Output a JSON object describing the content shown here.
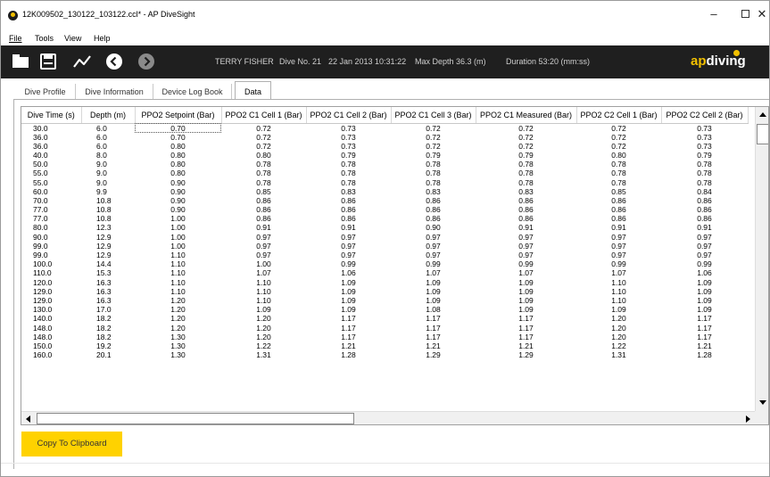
{
  "window": {
    "title": "12K009502_130122_103122.ccl* - AP DiveSight",
    "minimize": "–",
    "maximize": "",
    "close": "✕"
  },
  "menu": {
    "file": "File",
    "tools": "Tools",
    "view": "View",
    "help": "Help"
  },
  "toolbar": {
    "icons": [
      "open-folder-icon",
      "save-icon",
      "chart-line-icon",
      "back-arrow-icon",
      "forward-arrow-icon"
    ],
    "back_enabled": true,
    "forward_enabled": false
  },
  "dive_summary": {
    "diver": "TERRY FISHER",
    "dive_no": "Dive No. 21",
    "date": "22 Jan 2013 10:31:22",
    "max_depth": "Max Depth 36.3 (m)",
    "duration": "Duration 53:20 (mm:ss)"
  },
  "logo": {
    "ap": "ap",
    "diving": "diving"
  },
  "tabs": {
    "profile": "Dive Profile",
    "info": "Dive Information",
    "log": "Device Log Book",
    "data": "Data",
    "active": "Data"
  },
  "table": {
    "columns": [
      "Dive Time (s)",
      "Depth (m)",
      "PPO2 Setpoint (Bar)",
      "PPO2 C1 Cell 1 (Bar)",
      "PPO2 C1 Cell 2 (Bar)",
      "PPO2 C1 Cell 3 (Bar)",
      "PPO2 C1 Measured (Bar)",
      "PPO2 C2 Cell 1 (Bar)",
      "PPO2 C2 Cell 2 (Bar)"
    ],
    "rows": [
      [
        "30.0",
        "6.0",
        "0.70",
        "0.72",
        "0.73",
        "0.72",
        "0.72",
        "0.72",
        "0.73"
      ],
      [
        "36.0",
        "6.0",
        "0.70",
        "0.72",
        "0.73",
        "0.72",
        "0.72",
        "0.72",
        "0.73"
      ],
      [
        "36.0",
        "6.0",
        "0.80",
        "0.72",
        "0.73",
        "0.72",
        "0.72",
        "0.72",
        "0.73"
      ],
      [
        "40.0",
        "8.0",
        "0.80",
        "0.80",
        "0.79",
        "0.79",
        "0.79",
        "0.80",
        "0.79"
      ],
      [
        "50.0",
        "9.0",
        "0.80",
        "0.78",
        "0.78",
        "0.78",
        "0.78",
        "0.78",
        "0.78"
      ],
      [
        "55.0",
        "9.0",
        "0.80",
        "0.78",
        "0.78",
        "0.78",
        "0.78",
        "0.78",
        "0.78"
      ],
      [
        "55.0",
        "9.0",
        "0.90",
        "0.78",
        "0.78",
        "0.78",
        "0.78",
        "0.78",
        "0.78"
      ],
      [
        "60.0",
        "9.9",
        "0.90",
        "0.85",
        "0.83",
        "0.83",
        "0.83",
        "0.85",
        "0.84"
      ],
      [
        "70.0",
        "10.8",
        "0.90",
        "0.86",
        "0.86",
        "0.86",
        "0.86",
        "0.86",
        "0.86"
      ],
      [
        "77.0",
        "10.8",
        "0.90",
        "0.86",
        "0.86",
        "0.86",
        "0.86",
        "0.86",
        "0.86"
      ],
      [
        "77.0",
        "10.8",
        "1.00",
        "0.86",
        "0.86",
        "0.86",
        "0.86",
        "0.86",
        "0.86"
      ],
      [
        "80.0",
        "12.3",
        "1.00",
        "0.91",
        "0.91",
        "0.90",
        "0.91",
        "0.91",
        "0.91"
      ],
      [
        "90.0",
        "12.9",
        "1.00",
        "0.97",
        "0.97",
        "0.97",
        "0.97",
        "0.97",
        "0.97"
      ],
      [
        "99.0",
        "12.9",
        "1.00",
        "0.97",
        "0.97",
        "0.97",
        "0.97",
        "0.97",
        "0.97"
      ],
      [
        "99.0",
        "12.9",
        "1.10",
        "0.97",
        "0.97",
        "0.97",
        "0.97",
        "0.97",
        "0.97"
      ],
      [
        "100.0",
        "14.4",
        "1.10",
        "1.00",
        "0.99",
        "0.99",
        "0.99",
        "0.99",
        "0.99"
      ],
      [
        "110.0",
        "15.3",
        "1.10",
        "1.07",
        "1.06",
        "1.07",
        "1.07",
        "1.07",
        "1.06"
      ],
      [
        "120.0",
        "16.3",
        "1.10",
        "1.10",
        "1.09",
        "1.09",
        "1.09",
        "1.10",
        "1.09"
      ],
      [
        "129.0",
        "16.3",
        "1.10",
        "1.10",
        "1.09",
        "1.09",
        "1.09",
        "1.10",
        "1.09"
      ],
      [
        "129.0",
        "16.3",
        "1.20",
        "1.10",
        "1.09",
        "1.09",
        "1.09",
        "1.10",
        "1.09"
      ],
      [
        "130.0",
        "17.0",
        "1.20",
        "1.09",
        "1.09",
        "1.08",
        "1.09",
        "1.09",
        "1.09"
      ],
      [
        "140.0",
        "18.2",
        "1.20",
        "1.20",
        "1.17",
        "1.17",
        "1.17",
        "1.20",
        "1.17"
      ],
      [
        "148.0",
        "18.2",
        "1.20",
        "1.20",
        "1.17",
        "1.17",
        "1.17",
        "1.20",
        "1.17"
      ],
      [
        "148.0",
        "18.2",
        "1.30",
        "1.20",
        "1.17",
        "1.17",
        "1.17",
        "1.20",
        "1.17"
      ],
      [
        "150.0",
        "19.2",
        "1.30",
        "1.22",
        "1.21",
        "1.21",
        "1.21",
        "1.22",
        "1.21"
      ],
      [
        "160.0",
        "20.1",
        "1.30",
        "1.31",
        "1.28",
        "1.29",
        "1.29",
        "1.31",
        "1.28"
      ]
    ],
    "selected_cell": [
      0,
      2
    ]
  },
  "copy_button": {
    "label": "Copy To Clipboard"
  },
  "colors": {
    "toolbar_bg": "#1f1f1f",
    "accent_yellow": "#ffd200",
    "logo_yellow": "#f2c000",
    "summary_text": "#cfcfcf"
  }
}
